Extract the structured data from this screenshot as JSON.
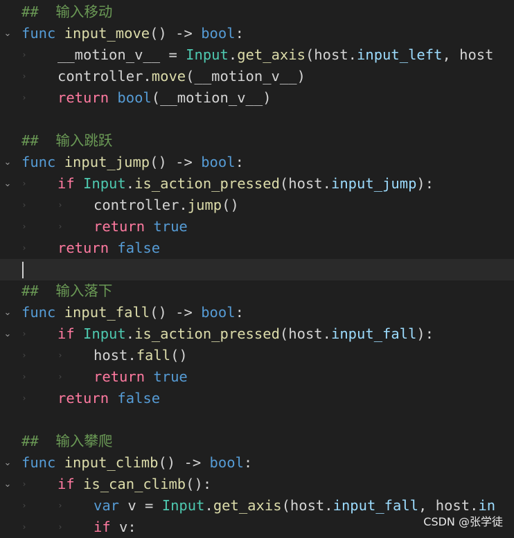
{
  "colors": {
    "background": "#1f1f1f",
    "comment": "#6a9955",
    "keyword": "#569cd6",
    "control": "#ff7aa0",
    "function": "#dcdcaa",
    "class": "#4ec9b0",
    "property": "#9cdcfe",
    "text": "#d4d4d4"
  },
  "watermark": "CSDN @张学徒",
  "lines": [
    {
      "fold": "",
      "indent": 0,
      "tokens": [
        [
          "cmt",
          "##  输入移动"
        ]
      ]
    },
    {
      "fold": "⌄",
      "indent": 0,
      "tokens": [
        [
          "kw",
          "func"
        ],
        [
          "txt",
          " "
        ],
        [
          "fn",
          "input_move"
        ],
        [
          "txt",
          "() -> "
        ],
        [
          "kw",
          "bool"
        ],
        [
          "txt",
          ":"
        ]
      ]
    },
    {
      "fold": "",
      "indent": 1,
      "tokens": [
        [
          "txt",
          "__motion_v__ = "
        ],
        [
          "cls",
          "Input"
        ],
        [
          "txt",
          "."
        ],
        [
          "fn",
          "get_axis"
        ],
        [
          "txt",
          "(host."
        ],
        [
          "prop",
          "input_left"
        ],
        [
          "txt",
          ", host"
        ]
      ]
    },
    {
      "fold": "",
      "indent": 1,
      "tokens": [
        [
          "txt",
          "controller."
        ],
        [
          "fn",
          "move"
        ],
        [
          "txt",
          "(__motion_v__)"
        ]
      ]
    },
    {
      "fold": "",
      "indent": 1,
      "tokens": [
        [
          "ctl",
          "return"
        ],
        [
          "txt",
          " "
        ],
        [
          "kw",
          "bool"
        ],
        [
          "txt",
          "(__motion_v__)"
        ]
      ]
    },
    {
      "fold": "",
      "indent": 0,
      "tokens": []
    },
    {
      "fold": "",
      "indent": 0,
      "tokens": [
        [
          "cmt",
          "##  输入跳跃"
        ]
      ]
    },
    {
      "fold": "⌄",
      "indent": 0,
      "tokens": [
        [
          "kw",
          "func"
        ],
        [
          "txt",
          " "
        ],
        [
          "fn",
          "input_jump"
        ],
        [
          "txt",
          "() -> "
        ],
        [
          "kw",
          "bool"
        ],
        [
          "txt",
          ":"
        ]
      ]
    },
    {
      "fold": "⌄",
      "indent": 1,
      "tokens": [
        [
          "ctl",
          "if"
        ],
        [
          "txt",
          " "
        ],
        [
          "cls",
          "Input"
        ],
        [
          "txt",
          "."
        ],
        [
          "fn",
          "is_action_pressed"
        ],
        [
          "txt",
          "(host."
        ],
        [
          "prop",
          "input_jump"
        ],
        [
          "txt",
          "):"
        ]
      ]
    },
    {
      "fold": "",
      "indent": 2,
      "tokens": [
        [
          "txt",
          "controller."
        ],
        [
          "fn",
          "jump"
        ],
        [
          "txt",
          "()"
        ]
      ]
    },
    {
      "fold": "",
      "indent": 2,
      "tokens": [
        [
          "ctl",
          "return"
        ],
        [
          "txt",
          " "
        ],
        [
          "kw",
          "true"
        ]
      ]
    },
    {
      "fold": "",
      "indent": 1,
      "tokens": [
        [
          "ctl",
          "return"
        ],
        [
          "txt",
          " "
        ],
        [
          "kw",
          "false"
        ]
      ]
    },
    {
      "fold": "",
      "indent": 0,
      "current": true,
      "tokens": []
    },
    {
      "fold": "",
      "indent": 0,
      "tokens": [
        [
          "cmt",
          "##  输入落下"
        ]
      ]
    },
    {
      "fold": "⌄",
      "indent": 0,
      "tokens": [
        [
          "kw",
          "func"
        ],
        [
          "txt",
          " "
        ],
        [
          "fn",
          "input_fall"
        ],
        [
          "txt",
          "() -> "
        ],
        [
          "kw",
          "bool"
        ],
        [
          "txt",
          ":"
        ]
      ]
    },
    {
      "fold": "⌄",
      "indent": 1,
      "tokens": [
        [
          "ctl",
          "if"
        ],
        [
          "txt",
          " "
        ],
        [
          "cls",
          "Input"
        ],
        [
          "txt",
          "."
        ],
        [
          "fn",
          "is_action_pressed"
        ],
        [
          "txt",
          "(host."
        ],
        [
          "prop",
          "input_fall"
        ],
        [
          "txt",
          "):"
        ]
      ]
    },
    {
      "fold": "",
      "indent": 2,
      "tokens": [
        [
          "txt",
          "host."
        ],
        [
          "fn",
          "fall"
        ],
        [
          "txt",
          "()"
        ]
      ]
    },
    {
      "fold": "",
      "indent": 2,
      "tokens": [
        [
          "ctl",
          "return"
        ],
        [
          "txt",
          " "
        ],
        [
          "kw",
          "true"
        ]
      ]
    },
    {
      "fold": "",
      "indent": 1,
      "tokens": [
        [
          "ctl",
          "return"
        ],
        [
          "txt",
          " "
        ],
        [
          "kw",
          "false"
        ]
      ]
    },
    {
      "fold": "",
      "indent": 0,
      "tokens": []
    },
    {
      "fold": "",
      "indent": 0,
      "tokens": [
        [
          "cmt",
          "##  输入攀爬"
        ]
      ]
    },
    {
      "fold": "⌄",
      "indent": 0,
      "tokens": [
        [
          "kw",
          "func"
        ],
        [
          "txt",
          " "
        ],
        [
          "fn",
          "input_climb"
        ],
        [
          "txt",
          "() -> "
        ],
        [
          "kw",
          "bool"
        ],
        [
          "txt",
          ":"
        ]
      ]
    },
    {
      "fold": "⌄",
      "indent": 1,
      "tokens": [
        [
          "ctl",
          "if"
        ],
        [
          "txt",
          " "
        ],
        [
          "fn",
          "is_can_climb"
        ],
        [
          "txt",
          "():"
        ]
      ]
    },
    {
      "fold": "",
      "indent": 2,
      "tokens": [
        [
          "kw",
          "var"
        ],
        [
          "txt",
          " v = "
        ],
        [
          "cls",
          "Input"
        ],
        [
          "txt",
          "."
        ],
        [
          "fn",
          "get_axis"
        ],
        [
          "txt",
          "(host."
        ],
        [
          "prop",
          "input_fall"
        ],
        [
          "txt",
          ", host."
        ],
        [
          "prop",
          "in"
        ]
      ]
    },
    {
      "fold": "",
      "indent": 2,
      "tokens": [
        [
          "ctl",
          "if"
        ],
        [
          "txt",
          " v:"
        ]
      ]
    }
  ]
}
